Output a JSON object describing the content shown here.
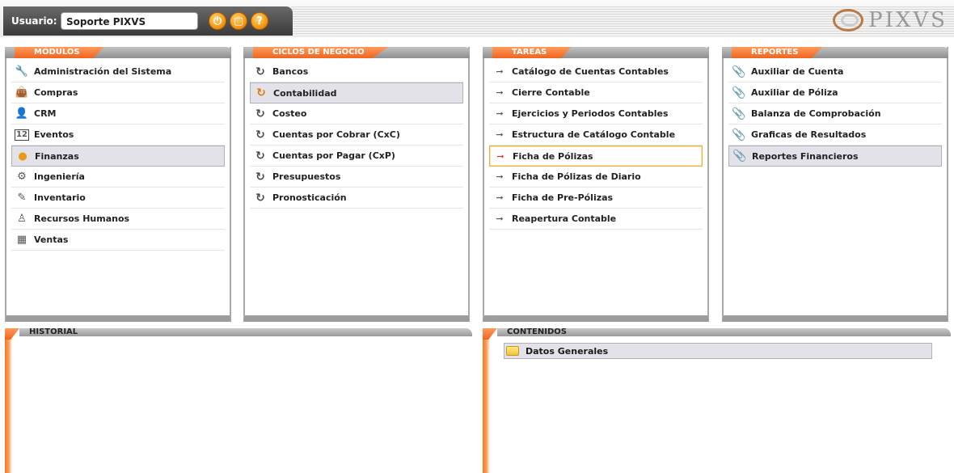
{
  "topbar": {
    "user_label": "Usuario:",
    "user_value": "Soporte PIXVS",
    "buttons": [
      {
        "icon": "power-icon",
        "glyph": "⏻"
      },
      {
        "icon": "stop-icon",
        "glyph": "▢"
      },
      {
        "icon": "help-icon",
        "glyph": "?"
      }
    ],
    "logo_text": "PIXVS"
  },
  "panels": {
    "modulos": {
      "title": "MÓDULOS",
      "items": [
        {
          "label": "Administración del Sistema",
          "icon": "wrench-icon"
        },
        {
          "label": "Compras",
          "icon": "bag-icon"
        },
        {
          "label": "CRM",
          "icon": "person-icon"
        },
        {
          "label": "Eventos",
          "icon": "calendar-icon"
        },
        {
          "label": "Finanzas",
          "icon": "coins-icon",
          "selected": true
        },
        {
          "label": "Ingeniería",
          "icon": "gears-icon"
        },
        {
          "label": "Inventario",
          "icon": "check-icon"
        },
        {
          "label": "Recursos Humanos",
          "icon": "worker-icon"
        },
        {
          "label": "Ventas",
          "icon": "cart-icon"
        }
      ]
    },
    "ciclos": {
      "title": "CICLOS DE NEGOCIO",
      "items": [
        {
          "label": "Bancos"
        },
        {
          "label": "Contabilidad",
          "selected": true
        },
        {
          "label": "Costeo"
        },
        {
          "label": "Cuentas por Cobrar (CxC)"
        },
        {
          "label": "Cuentas por Pagar (CxP)"
        },
        {
          "label": "Presupuestos"
        },
        {
          "label": "Pronosticación"
        }
      ]
    },
    "tareas": {
      "title": "TAREAS",
      "items": [
        {
          "label": "Catálogo de Cuentas Contables"
        },
        {
          "label": "Cierre Contable"
        },
        {
          "label": "Ejercicios y Periodos Contables"
        },
        {
          "label": "Estructura de Catálogo Contable"
        },
        {
          "label": "Ficha de Pólizas",
          "selected": true
        },
        {
          "label": "Ficha de Pólizas de Diario"
        },
        {
          "label": "Ficha de Pre-Pólizas"
        },
        {
          "label": "Reapertura Contable"
        }
      ]
    },
    "reportes": {
      "title": "REPORTES",
      "items": [
        {
          "label": "Auxiliar de Cuenta"
        },
        {
          "label": "Auxiliar de Póliza"
        },
        {
          "label": "Balanza de Comprobación"
        },
        {
          "label": "Graficas de Resultados"
        },
        {
          "label": "Reportes Financieros",
          "selected": true
        }
      ]
    }
  },
  "historial": {
    "title": "HISTORIAL"
  },
  "contenidos": {
    "title": "CONTENIDOS",
    "items": [
      {
        "label": "Datos Generales"
      }
    ]
  }
}
